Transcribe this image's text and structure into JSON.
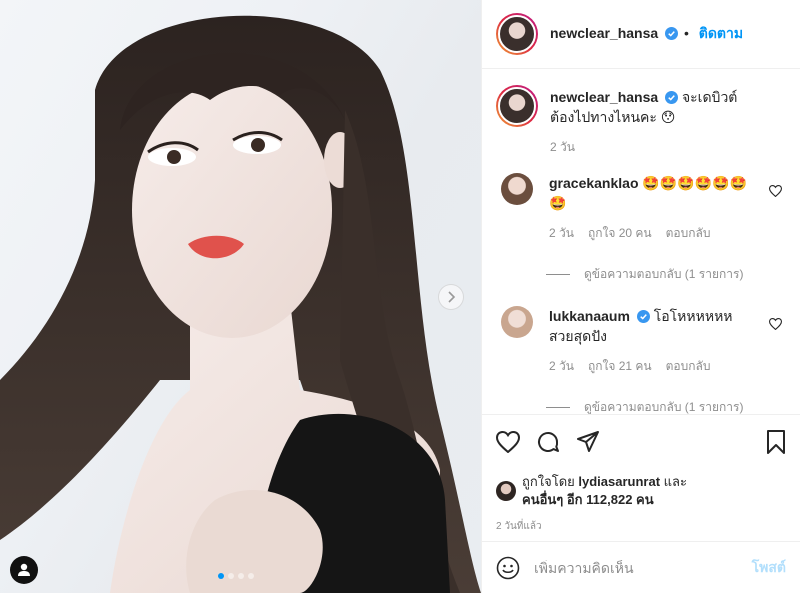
{
  "post": {
    "carousel": {
      "total": 4,
      "active": 1
    }
  },
  "header": {
    "username": "newclear_hansa",
    "separator": "•",
    "follow_label": "ติดตาม"
  },
  "caption": {
    "username": "newclear_hansa",
    "text": "จะเดบิวต์ต้องไปทางไหนคะ 😯",
    "time": "2 วัน"
  },
  "comments": [
    {
      "username": "gracekanklao",
      "text": "🤩🤩🤩🤩🤩🤩🤩",
      "time": "2 วัน",
      "likes": "ถูกใจ 20 คน",
      "reply_label": "ตอบกลับ",
      "view_replies": "ดูข้อความตอบกลับ (1 รายการ)"
    },
    {
      "username": "lukkanaaum",
      "text": "โอโหหหหหห สวยสุดปัง",
      "time": "2 วัน",
      "likes": "ถูกใจ 21 คน",
      "reply_label": "ตอบกลับ",
      "view_replies": "ดูข้อความตอบกลับ (1 รายการ)"
    }
  ],
  "likes_line": {
    "prefix": "ถูกใจโดย",
    "user": "lydiasarunrat",
    "and": "และ",
    "others": "คนอื่นๆ อีก 112,822 คน"
  },
  "posted_time": "2 วันที่แล้ว",
  "add_comment": {
    "placeholder": "เพิ่มความคิดเห็น",
    "post_label": "โพสต์"
  },
  "colors": {
    "accent": "#0095f6",
    "verified": "#3897f0",
    "post_disabled": "#b2dffc"
  }
}
